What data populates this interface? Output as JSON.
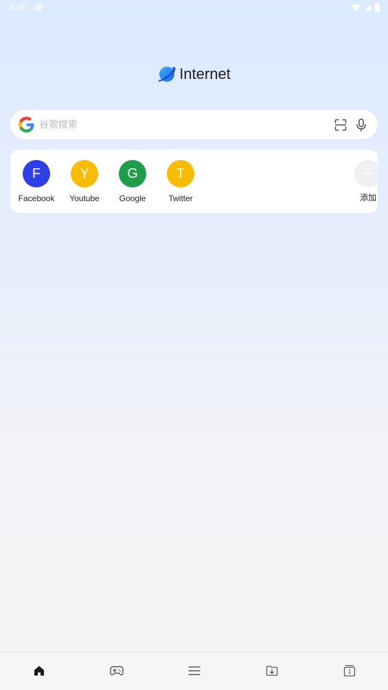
{
  "status_bar": {
    "time": "4:08"
  },
  "brand": {
    "name": "Internet",
    "logo_icon": "planet-icon"
  },
  "search": {
    "placeholder": "谷歌搜索",
    "engine_icon": "google-g-icon",
    "scan_icon": "scan-icon",
    "mic_icon": "microphone-icon"
  },
  "shortcuts": {
    "items": [
      {
        "letter": "F",
        "label": "Facebook",
        "color": "#2f3fe6"
      },
      {
        "letter": "Y",
        "label": "Youtube",
        "color": "#fbbc05"
      },
      {
        "letter": "G",
        "label": "Google",
        "color": "#1e9e4a"
      },
      {
        "letter": "T",
        "label": "Twitter",
        "color": "#fbbc05"
      }
    ],
    "add_label": "添加"
  },
  "bottom_nav": {
    "tab_count": "1",
    "items": [
      "home-icon",
      "gamepad-icon",
      "menu-icon",
      "download-folder-icon",
      "tabs-icon"
    ]
  },
  "colors": {
    "accent": "#4285f4"
  }
}
